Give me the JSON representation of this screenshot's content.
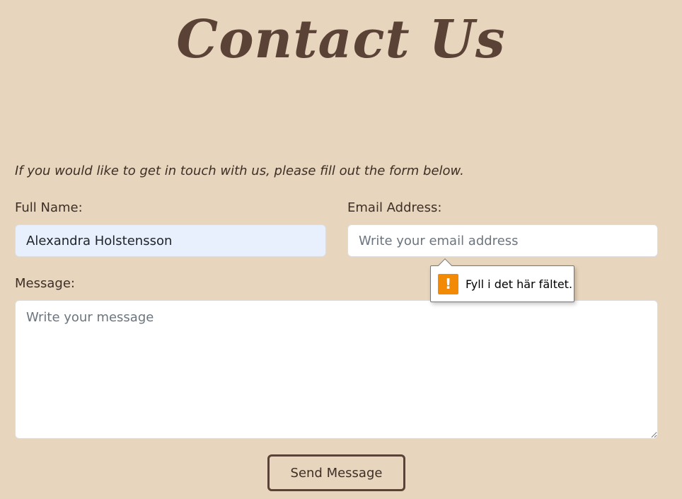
{
  "page": {
    "title": "Contact Us"
  },
  "intro": "If you would like to get in touch with us, please fill out the form below.",
  "form": {
    "full_name": {
      "label": "Full Name:",
      "value": "Alexandra Holstensson"
    },
    "email": {
      "label": "Email Address:",
      "value": "",
      "placeholder": "Write your email address"
    },
    "message": {
      "label": "Message:",
      "value": "",
      "placeholder": "Write your message"
    },
    "submit_label": "Send Message"
  },
  "validation_tooltip": {
    "icon": "warning-icon",
    "text": "Fyll i det här fältet."
  },
  "colors": {
    "background": "#e8d5bd",
    "heading": "#5a4236",
    "autofill": "#e8f0fe",
    "warning": "#f28a05"
  }
}
